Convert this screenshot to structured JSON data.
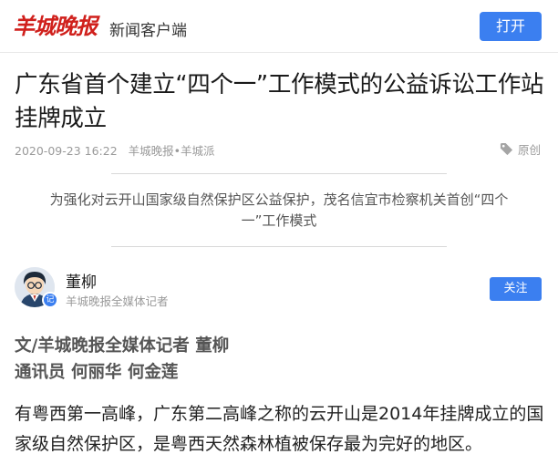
{
  "header": {
    "logo_text": "羊城晚报",
    "subtitle": "新闻客户端",
    "open_label": "打开"
  },
  "article": {
    "title": "广东省首个建立“四个一”工作模式的公益诉讼工作站挂牌成立",
    "date": "2020-09-23 16:22",
    "source": "羊城晚报•羊城派",
    "original_label": "原创",
    "summary": "为强化对云开山国家级自然保护区公益保护，茂名信宜市检察机关首创“四个一”工作模式",
    "byline_line1": "文/羊城晚报全媒体记者 董柳",
    "byline_line2": "通讯员 何丽华 何金莲",
    "body": "有粤西第一高峰，广东第二高峰之称的云开山是2014年挂牌成立的国家级自然保护区，是粤西天然森林植被保存最为完好的地区。"
  },
  "author": {
    "name": "董柳",
    "title": "羊城晚报全媒体记者",
    "badge": "记",
    "follow_label": "关注"
  },
  "colors": {
    "brand_red": "#d0201c",
    "accent_blue": "#3b7ff0"
  },
  "icons": [
    "tag-icon",
    "avatar-image",
    "verified-badge"
  ]
}
